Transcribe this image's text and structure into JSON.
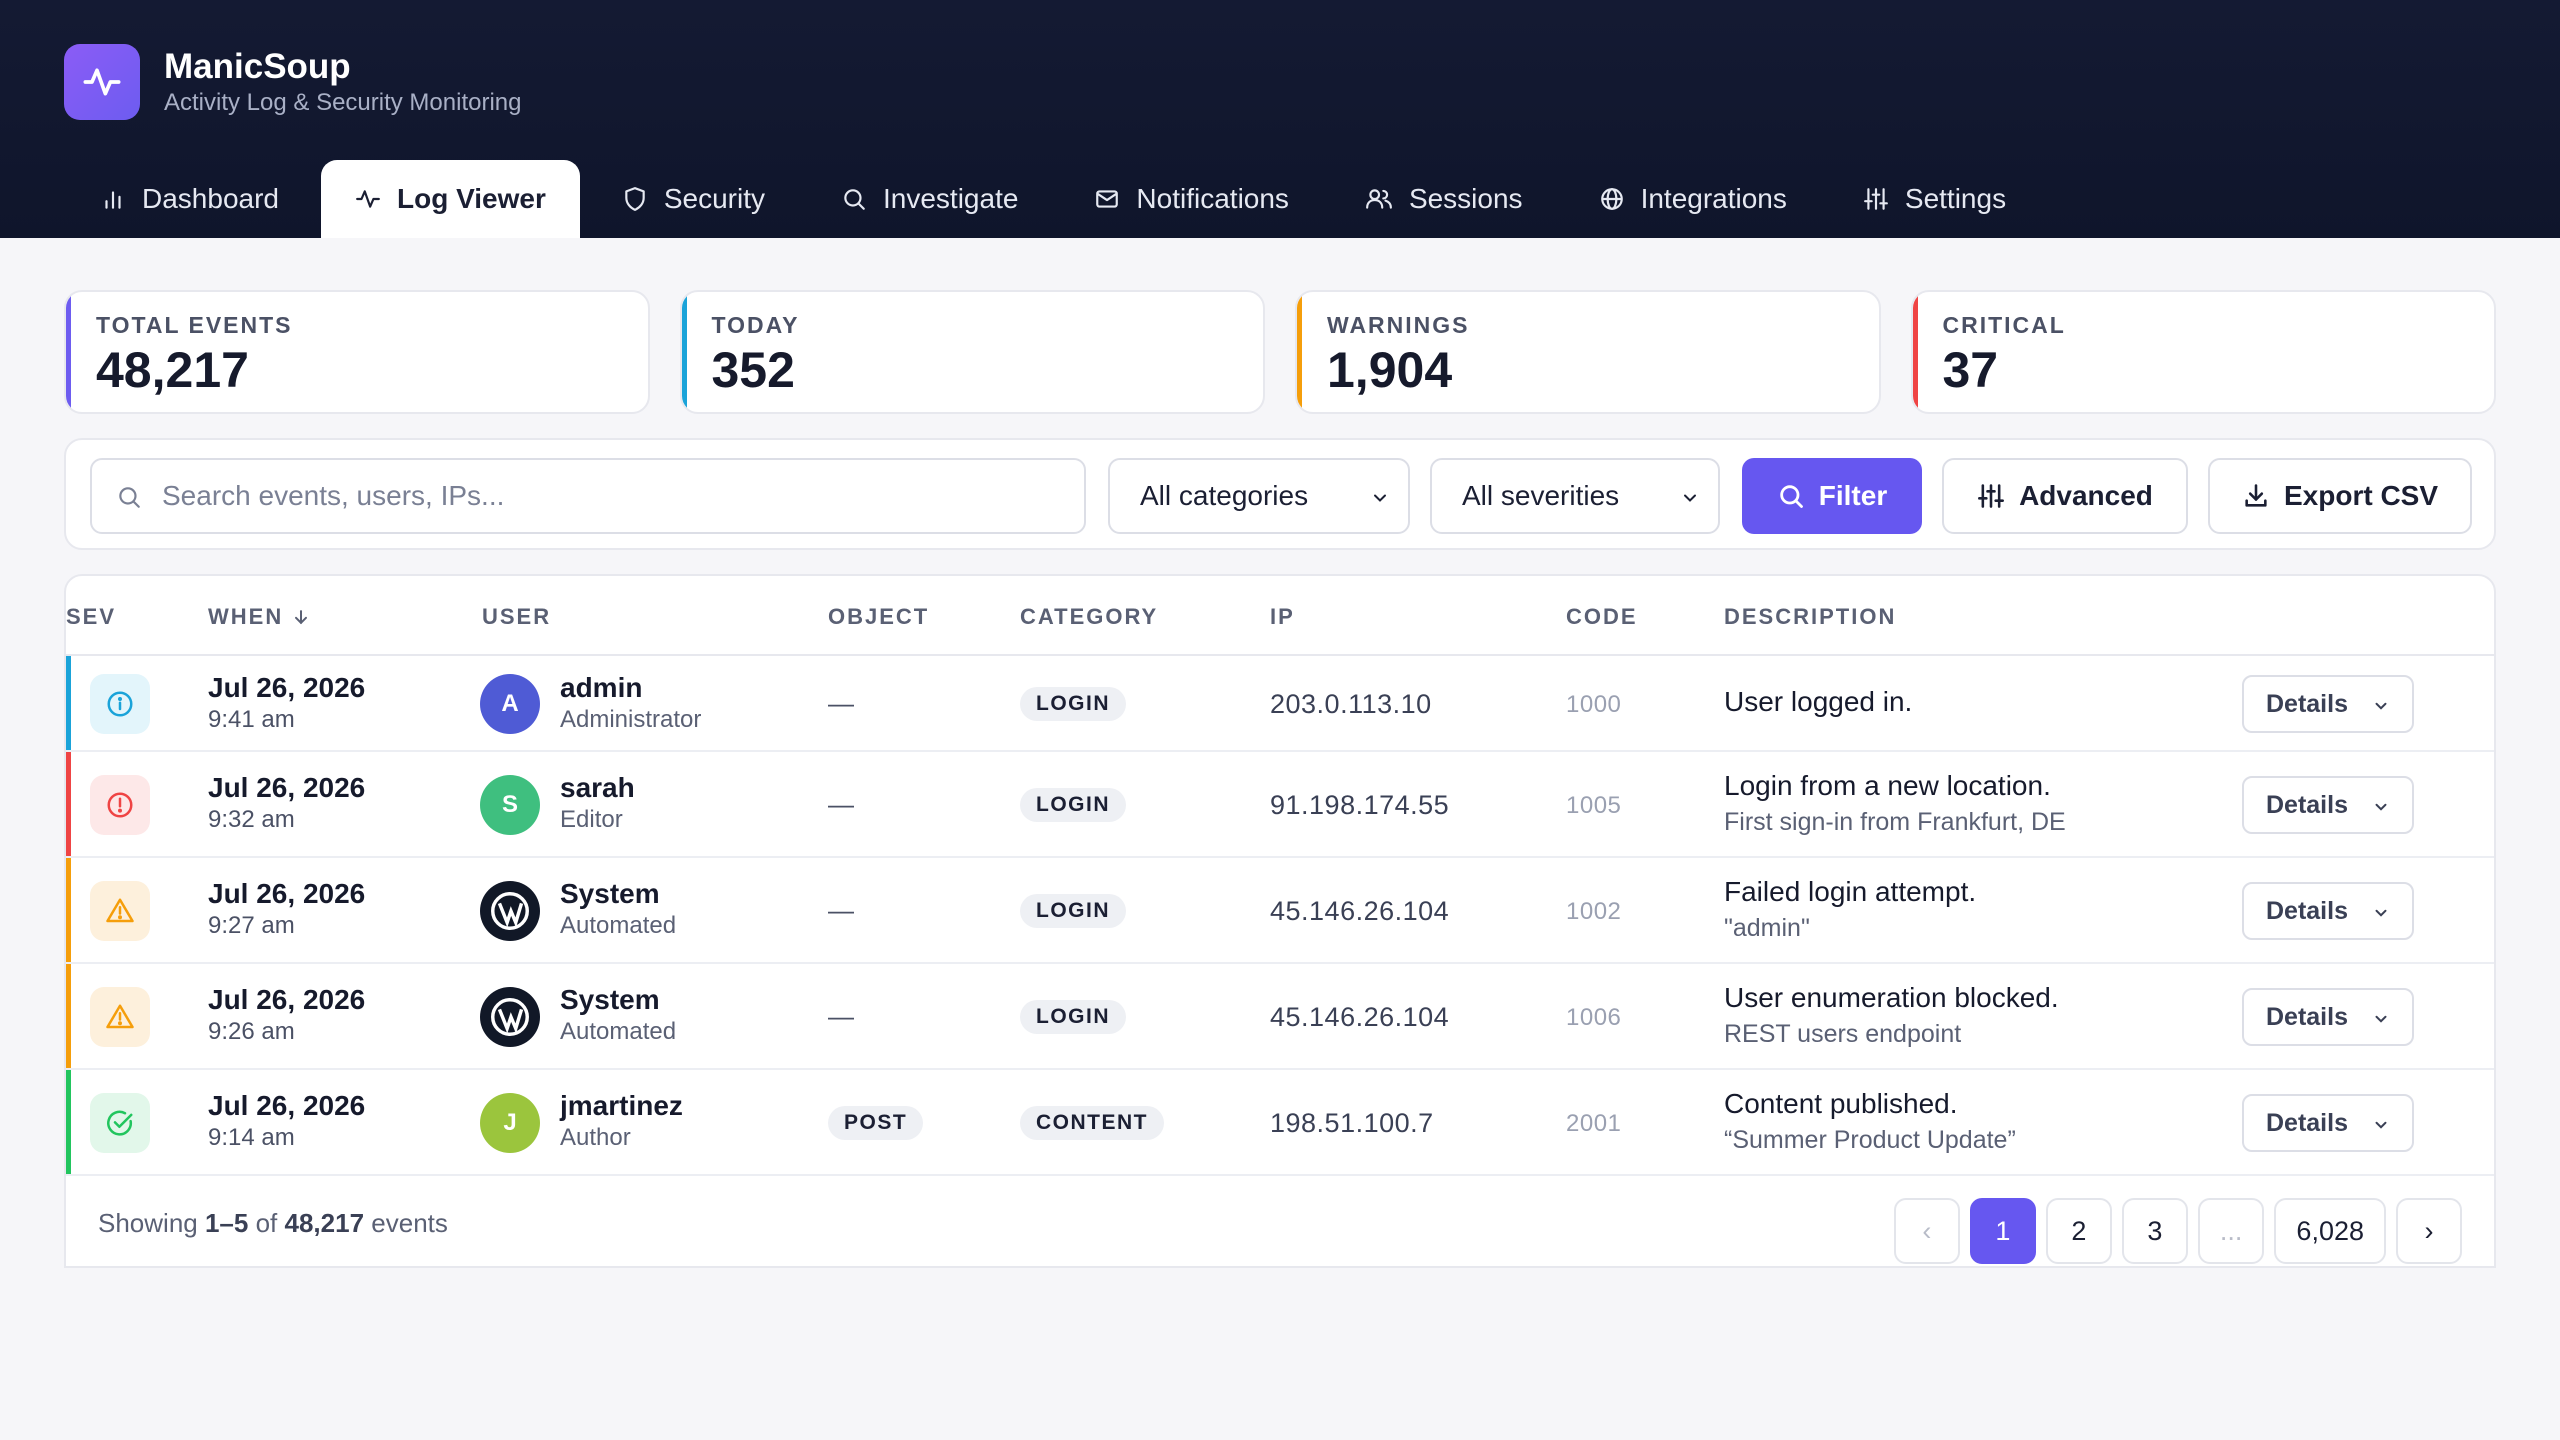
{
  "app": {
    "name": "ManicSoup",
    "subtitle": "Activity Log & Security Monitoring"
  },
  "tabs": [
    {
      "label": "Dashboard",
      "icon": "bar-chart-icon"
    },
    {
      "label": "Log Viewer",
      "icon": "activity-icon",
      "active": true
    },
    {
      "label": "Security",
      "icon": "shield-icon"
    },
    {
      "label": "Investigate",
      "icon": "search-icon"
    },
    {
      "label": "Notifications",
      "icon": "mail-icon"
    },
    {
      "label": "Sessions",
      "icon": "users-icon"
    },
    {
      "label": "Integrations",
      "icon": "globe-icon"
    },
    {
      "label": "Settings",
      "icon": "sliders-icon"
    }
  ],
  "stats": [
    {
      "label": "TOTAL EVENTS",
      "value": "48,217",
      "color": "#6d5cf0"
    },
    {
      "label": "TODAY",
      "value": "352",
      "color": "#1aa3d9"
    },
    {
      "label": "WARNINGS",
      "value": "1,904",
      "color": "#f59e0b"
    },
    {
      "label": "CRITICAL",
      "value": "37",
      "color": "#ef4444"
    }
  ],
  "filters": {
    "search_placeholder": "Search events, users, IPs...",
    "category_value": "All categories",
    "severity_value": "All severities",
    "filter_label": "Filter",
    "advanced_label": "Advanced",
    "export_label": "Export CSV"
  },
  "table": {
    "headers": {
      "sev": "SEV",
      "when": "WHEN",
      "user": "USER",
      "object": "OBJECT",
      "category": "CATEGORY",
      "ip": "IP",
      "code": "CODE",
      "description": "DESCRIPTION"
    },
    "details_label": "Details",
    "rows": [
      {
        "severity": "info",
        "date": "Jul 26, 2026",
        "time": "9:41 am",
        "avatar": "A",
        "avatar_color": "#4f5bd5",
        "user": "admin",
        "role": "Administrator",
        "object": "—",
        "category": "LOGIN",
        "ip": "203.0.113.10",
        "code": "1000",
        "desc": "User logged in.",
        "desc_sub": ""
      },
      {
        "severity": "critical",
        "date": "Jul 26, 2026",
        "time": "9:32 am",
        "avatar": "S",
        "avatar_color": "#3fbf7f",
        "user": "sarah",
        "role": "Editor",
        "object": "—",
        "category": "LOGIN",
        "ip": "91.198.174.55",
        "code": "1005",
        "desc": "Login from a new location.",
        "desc_sub": "First sign-in from Frankfurt, DE"
      },
      {
        "severity": "warning",
        "date": "Jul 26, 2026",
        "time": "9:27 am",
        "avatar": "",
        "avatar_color": "#111827",
        "user": "System",
        "role": "Automated",
        "object": "—",
        "category": "LOGIN",
        "ip": "45.146.26.104",
        "code": "1002",
        "desc": "Failed login attempt.",
        "desc_sub": "\"admin\""
      },
      {
        "severity": "warning",
        "date": "Jul 26, 2026",
        "time": "9:26 am",
        "avatar": "",
        "avatar_color": "#111827",
        "user": "System",
        "role": "Automated",
        "object": "—",
        "category": "LOGIN",
        "ip": "45.146.26.104",
        "code": "1006",
        "desc": "User enumeration blocked.",
        "desc_sub": "REST users endpoint"
      },
      {
        "severity": "success",
        "date": "Jul 26, 2026",
        "time": "9:14 am",
        "avatar": "J",
        "avatar_color": "#9bc53d",
        "user": "jmartinez",
        "role": "Author",
        "object": "POST",
        "category": "CONTENT",
        "ip": "198.51.100.7",
        "code": "2001",
        "desc": "Content published.",
        "desc_sub": "“Summer Product Update”"
      }
    ]
  },
  "footer": {
    "showing_prefix": "Showing",
    "range": "1–5",
    "of": "of",
    "total": "48,217",
    "suffix": "events",
    "pages": [
      "‹",
      "1",
      "2",
      "3",
      "...",
      "6,028",
      "›"
    ]
  }
}
